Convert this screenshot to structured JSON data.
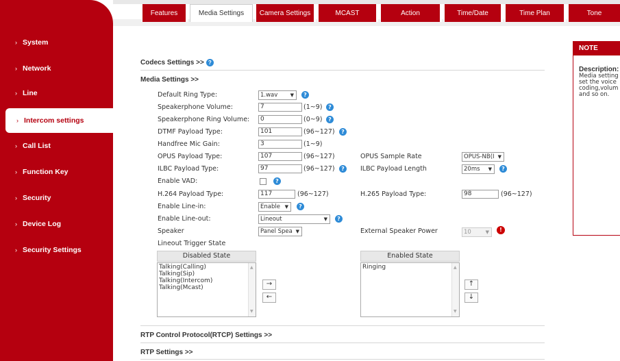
{
  "tabs": [
    "Features",
    "Media Settings",
    "Camera Settings",
    "MCAST",
    "Action",
    "Time/Date",
    "Time Plan",
    "Tone"
  ],
  "active_tab": "Media Settings",
  "sidebar": {
    "items": [
      {
        "label": "System"
      },
      {
        "label": "Network"
      },
      {
        "label": "Line"
      },
      {
        "label": "Intercom settings",
        "active": true
      },
      {
        "label": "Call List"
      },
      {
        "label": "Function Key"
      },
      {
        "label": "Security"
      },
      {
        "label": "Device Log"
      },
      {
        "label": "Security Settings"
      }
    ]
  },
  "sections": {
    "codecs": "Codecs Settings >>",
    "media": "Media Settings >>",
    "rtcp": "RTP Control Protocol(RTCP) Settings >>",
    "rtp": "RTP Settings >>"
  },
  "fields": {
    "default_ring_type": {
      "label": "Default Ring Type:",
      "value": "1.wav"
    },
    "speakerphone_volume": {
      "label": "Speakerphone Volume:",
      "value": "7",
      "range": "(1~9)"
    },
    "speakerphone_ring_volume": {
      "label": "Speakerphone Ring Volume:",
      "value": "0",
      "range": "(0~9)"
    },
    "dtmf_payload_type": {
      "label": "DTMF Payload Type:",
      "value": "101",
      "range": "(96~127)"
    },
    "handfree_mic_gain": {
      "label": "Handfree Mic Gain:",
      "value": "3",
      "range": "(1~9)"
    },
    "opus_payload_type": {
      "label": "OPUS Payload Type:",
      "value": "107",
      "range": "(96~127)"
    },
    "opus_sample_rate": {
      "label": "OPUS Sample Rate",
      "value": "OPUS-NB(I"
    },
    "ilbc_payload_type": {
      "label": "ILBC Payload Type:",
      "value": "97",
      "range": "(96~127)"
    },
    "ilbc_payload_length": {
      "label": "ILBC Payload Length",
      "value": "20ms"
    },
    "enable_vad": {
      "label": "Enable VAD:",
      "checked": false
    },
    "h264_payload_type": {
      "label": "H.264 Payload Type:",
      "value": "117",
      "range": "(96~127)"
    },
    "h265_payload_type": {
      "label": "H.265 Payload Type:",
      "value": "98",
      "range": "(96~127)"
    },
    "enable_line_in": {
      "label": "Enable Line-in:",
      "value": "Enable"
    },
    "enable_line_out": {
      "label": "Enable Line-out:",
      "value": "Lineout"
    },
    "speaker": {
      "label": "Speaker",
      "value": "Panel Spea"
    },
    "external_speaker_power": {
      "label": "External Speaker Power",
      "value": "10"
    },
    "lineout_trigger_state": {
      "label": "Lineout Trigger State"
    }
  },
  "trigger": {
    "disabled_header": "Disabled State",
    "enabled_header": "Enabled State",
    "disabled_items": [
      "Talking(Calling)",
      "Talking(Sip)",
      "Talking(Intercom)",
      "Talking(Mcast)"
    ],
    "enabled_items": [
      "Ringing"
    ],
    "move_right": "→",
    "move_left": "←",
    "move_up": "↑",
    "move_down": "↓"
  },
  "note": {
    "header": "NOTE",
    "title": "Description:",
    "text": "Media setting\nset the voice\ncoding,volum\nand so on."
  },
  "colors": {
    "brand": "#b5000f",
    "help": "#2e8bd7"
  },
  "icons": {
    "help": "question-circle-icon",
    "warning": "alert-circle-icon"
  }
}
